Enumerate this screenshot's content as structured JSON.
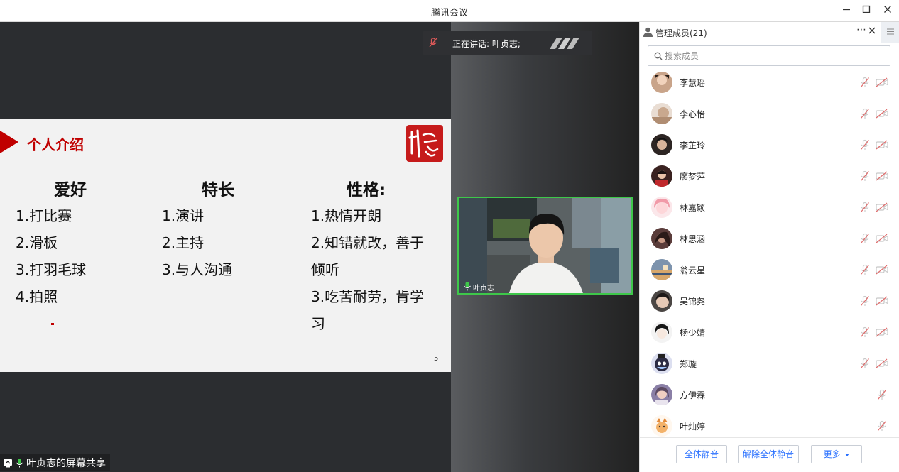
{
  "window": {
    "title": "腾讯会议"
  },
  "speaking": {
    "text": "正在讲话: 叶贞志;"
  },
  "slide": {
    "heading": "个人介绍",
    "columns": [
      {
        "title": "爱好",
        "items": [
          "1.打比赛",
          "2.滑板",
          "3.打羽毛球",
          "4.拍照"
        ]
      },
      {
        "title": "特长",
        "items": [
          "1.演讲",
          "2.主持",
          "3.与人沟通"
        ]
      },
      {
        "title": "性格:",
        "items": [
          "1.热情开朗",
          "2.知错就改，善于",
          "倾听",
          "3.吃苦耐劳，肯学",
          "习"
        ]
      }
    ],
    "page_number": "5"
  },
  "camera": {
    "name": "叶贞志"
  },
  "share_label": "叶贞志的屏幕共享",
  "panel": {
    "title": "管理成员(21)",
    "more_icon": "⋯",
    "search_placeholder": "搜索成员",
    "members": [
      {
        "name": "李慧瑶"
      },
      {
        "name": "李心怡"
      },
      {
        "name": "李芷玲"
      },
      {
        "name": "廖梦萍"
      },
      {
        "name": "林嘉颖"
      },
      {
        "name": "林思涵"
      },
      {
        "name": "翁云星"
      },
      {
        "name": "吴锦尧"
      },
      {
        "name": "杨少婧"
      },
      {
        "name": "郑璇"
      },
      {
        "name": "方伊霖"
      },
      {
        "name": "叶灿婷"
      }
    ],
    "footer": {
      "mute_all": "全体静音",
      "unmute_all": "解除全体静音",
      "more": "更多"
    }
  },
  "colors": {
    "accent": "#2970ff",
    "slide_red": "#c00000",
    "active_border": "#3ec74a"
  }
}
